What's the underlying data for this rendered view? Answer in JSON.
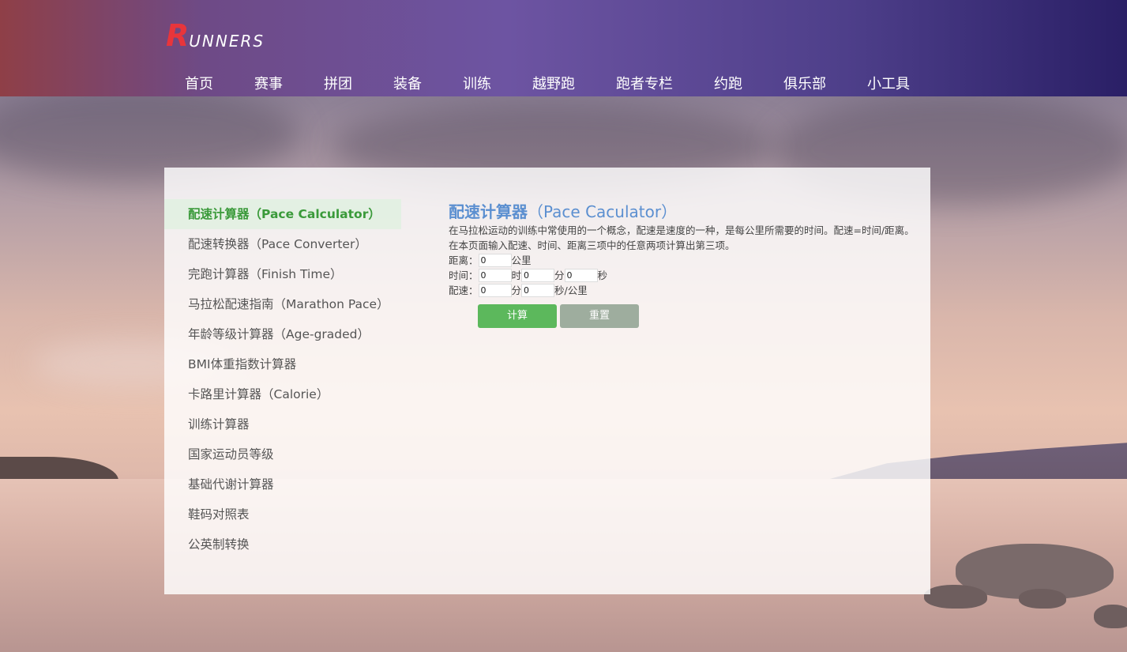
{
  "logo": {
    "first_letter": "R",
    "rest": "UNNERS"
  },
  "nav": [
    {
      "label": "首页"
    },
    {
      "label": "赛事"
    },
    {
      "label": "拼团"
    },
    {
      "label": "装备"
    },
    {
      "label": "训练"
    },
    {
      "label": "越野跑"
    },
    {
      "label": "跑者专栏"
    },
    {
      "label": "约跑"
    },
    {
      "label": "俱乐部"
    },
    {
      "label": "小工具"
    }
  ],
  "sidebar": {
    "items": [
      {
        "label": "配速计算器（Pace Calculator）",
        "active": true
      },
      {
        "label": "配速转换器（Pace Converter）"
      },
      {
        "label": "完跑计算器（Finish Time）"
      },
      {
        "label": "马拉松配速指南（Marathon Pace）"
      },
      {
        "label": "年龄等级计算器（Age-graded）"
      },
      {
        "label": "BMI体重指数计算器"
      },
      {
        "label": "卡路里计算器（Calorie）"
      },
      {
        "label": "训练计算器"
      },
      {
        "label": "国家运动员等级"
      },
      {
        "label": "基础代谢计算器"
      },
      {
        "label": "鞋码对照表"
      },
      {
        "label": "公英制转换"
      }
    ]
  },
  "calculator": {
    "title_cn": "配速计算器",
    "title_en": "（Pace Caculator）",
    "description": "在马拉松运动的训练中常使用的一个概念，配速是速度的一种，是每公里所需要的时间。配速=时间/距离。在本页面输入配速、时间、距离三项中的任意两项计算出第三项。",
    "distance": {
      "label": "距离：",
      "value": "0",
      "unit": "公里"
    },
    "time": {
      "label": "时间：",
      "hours": "0",
      "hours_unit": "时",
      "minutes": "0",
      "minutes_unit": "分",
      "seconds": "0",
      "seconds_unit": "秒"
    },
    "pace": {
      "label": "配速：",
      "minutes": "0",
      "minutes_unit": "分",
      "seconds": "0",
      "seconds_unit": "秒/公里"
    },
    "calculate_label": "计算",
    "reset_label": "重置"
  },
  "colors": {
    "accent_green": "#5cb85c",
    "active_green": "#3a9a3a",
    "title_blue": "#5b8fd0",
    "logo_red": "#e8353b",
    "reset_gray": "#9ead9e"
  }
}
